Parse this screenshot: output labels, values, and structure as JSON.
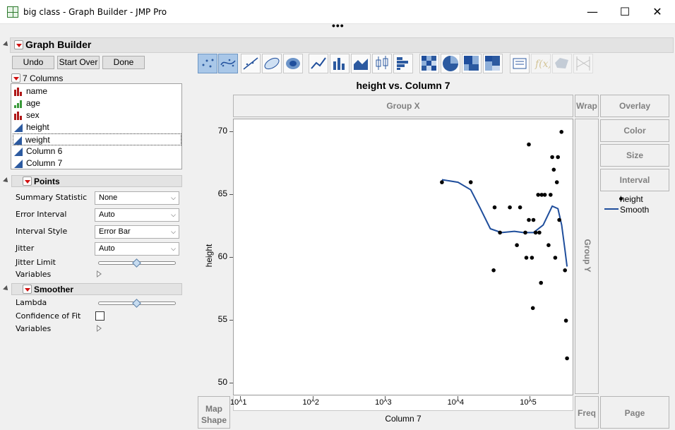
{
  "window": {
    "title": "big class - Graph Builder - JMP Pro",
    "minimize_glyph": "—",
    "maximize_glyph": "☐",
    "close_glyph": "✕",
    "overflow_dots": "•••"
  },
  "graph_builder": {
    "title": "Graph Builder",
    "buttons": {
      "undo": "Undo",
      "start_over": "Start Over",
      "done": "Done"
    },
    "columns_header": "7 Columns",
    "columns": [
      {
        "name": "name",
        "icon": "nominal-icon"
      },
      {
        "name": "age",
        "icon": "ordinal-icon"
      },
      {
        "name": "sex",
        "icon": "nominal-icon"
      },
      {
        "name": "height",
        "icon": "continuous-icon"
      },
      {
        "name": "weight",
        "icon": "continuous-icon"
      },
      {
        "name": "Column 6",
        "icon": "continuous-icon"
      },
      {
        "name": "Column 7",
        "icon": "continuous-icon"
      }
    ],
    "points": {
      "header": "Points",
      "summary_statistic_label": "Summary Statistic",
      "summary_statistic_value": "None",
      "error_interval_label": "Error Interval",
      "error_interval_value": "Auto",
      "interval_style_label": "Interval Style",
      "interval_style_value": "Error Bar",
      "jitter_label": "Jitter",
      "jitter_value": "Auto",
      "jitter_limit_label": "Jitter Limit",
      "jitter_limit_fraction": 0.5,
      "variables_label": "Variables"
    },
    "smoother": {
      "header": "Smoother",
      "lambda_label": "Lambda",
      "lambda_fraction": 0.5,
      "confidence_label": "Confidence of Fit",
      "variables_label": "Variables"
    }
  },
  "toolbar": {
    "icons": [
      "points-icon",
      "smoother-icon",
      "line-of-fit-icon",
      "ellipse-icon",
      "contour-icon",
      "line-icon",
      "bar-icon",
      "area-icon",
      "box-plot-icon",
      "histogram-icon",
      "heatmap-icon",
      "pie-icon",
      "treemap-icon",
      "mosaic-icon",
      "caption-box-icon",
      "formula-icon",
      "map-shape-icon",
      "parallel-icon"
    ]
  },
  "zones": {
    "group_x": "Group X",
    "wrap": "Wrap",
    "overlay": "Overlay",
    "color": "Color",
    "size": "Size",
    "interval": "Interval",
    "group_y": "Group Y",
    "map_shape_line1": "Map",
    "map_shape_line2": "Shape",
    "freq": "Freq",
    "page": "Page"
  },
  "legend": {
    "items": [
      {
        "label": "height",
        "kind": "point"
      },
      {
        "label": "Smooth",
        "kind": "line"
      }
    ]
  },
  "colors": {
    "smooth_line": "#1f4e9c",
    "point": "#000000",
    "selected_tool": "#a9c7e8"
  },
  "chart_data": {
    "type": "scatter",
    "title": "height vs. Column 7",
    "xlabel": "Column 7",
    "ylabel": "height",
    "x_scale": "log",
    "xlim": [
      8,
      400000
    ],
    "ylim": [
      49,
      71
    ],
    "y_ticks": [
      50,
      55,
      60,
      65,
      70
    ],
    "x_ticks": [
      {
        "value": 10,
        "label": "10^1"
      },
      {
        "value": 100,
        "label": "10^2"
      },
      {
        "value": 1000,
        "label": "10^3"
      },
      {
        "value": 10000,
        "label": "10^4"
      },
      {
        "value": 100000,
        "label": "10^5"
      }
    ],
    "grid": false,
    "series": [
      {
        "name": "height",
        "points": [
          [
            6000,
            66
          ],
          [
            15000,
            66
          ],
          [
            32000,
            64
          ],
          [
            31000,
            59
          ],
          [
            38000,
            62
          ],
          [
            52000,
            64
          ],
          [
            65000,
            61
          ],
          [
            72000,
            64
          ],
          [
            85000,
            62
          ],
          [
            88000,
            60
          ],
          [
            95000,
            69
          ],
          [
            95000,
            63
          ],
          [
            105000,
            60
          ],
          [
            108000,
            56
          ],
          [
            110000,
            63
          ],
          [
            118000,
            62
          ],
          [
            128000,
            65
          ],
          [
            133000,
            62
          ],
          [
            140000,
            58
          ],
          [
            143000,
            65
          ],
          [
            158000,
            65
          ],
          [
            178000,
            61
          ],
          [
            190000,
            65
          ],
          [
            200000,
            68
          ],
          [
            210000,
            67
          ],
          [
            220000,
            60
          ],
          [
            232000,
            66
          ],
          [
            240000,
            68
          ],
          [
            250000,
            63
          ],
          [
            268000,
            70
          ],
          [
            300000,
            59
          ],
          [
            310000,
            55
          ],
          [
            320000,
            52
          ]
        ]
      },
      {
        "name": "Smooth",
        "points": [
          [
            6000,
            66.2
          ],
          [
            10000,
            66.0
          ],
          [
            15000,
            65.4
          ],
          [
            20000,
            64.0
          ],
          [
            28000,
            62.3
          ],
          [
            40000,
            62.0
          ],
          [
            60000,
            62.1
          ],
          [
            80000,
            62.0
          ],
          [
            110000,
            62.0
          ],
          [
            150000,
            62.6
          ],
          [
            200000,
            64.1
          ],
          [
            240000,
            63.9
          ],
          [
            270000,
            62.6
          ],
          [
            300000,
            60.6
          ],
          [
            320000,
            59.3
          ]
        ]
      }
    ]
  }
}
